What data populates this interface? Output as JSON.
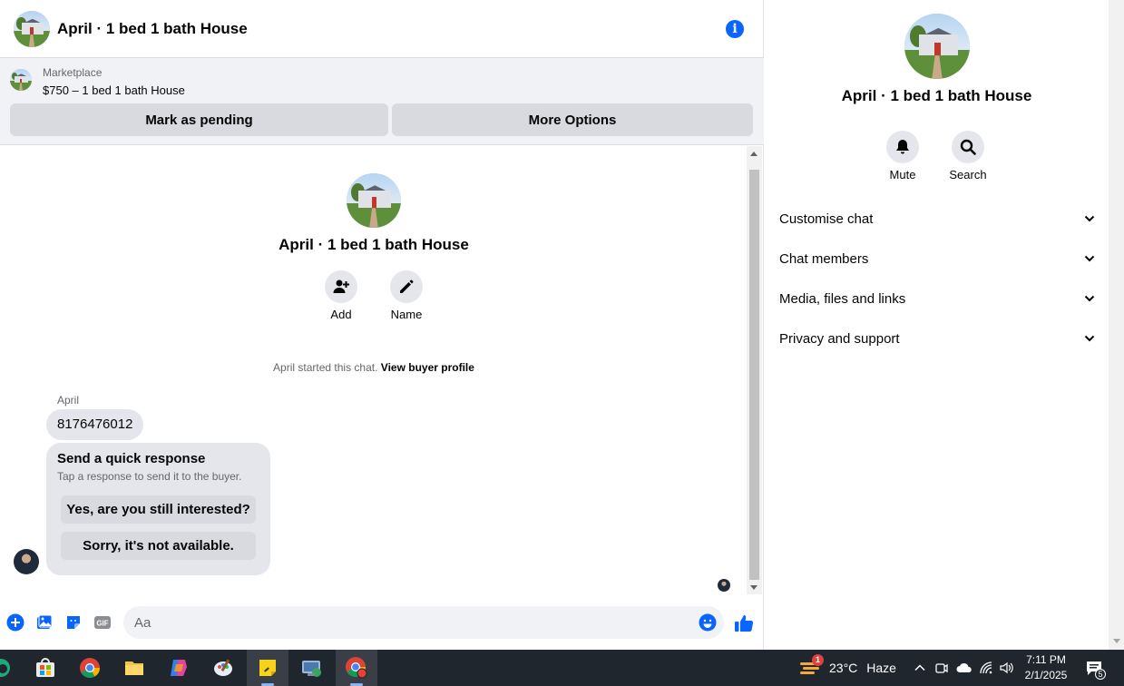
{
  "header": {
    "title": "April · 1 bed 1 bath House",
    "info_icon": "i"
  },
  "listing": {
    "source": "Marketplace",
    "price_title": "$750 – 1 bed 1 bath House",
    "mark_pending_label": "Mark as pending",
    "more_options_label": "More Options"
  },
  "intro": {
    "title": "April · 1 bed 1 bath House",
    "add_label": "Add",
    "name_label": "Name",
    "started_text": "April started this chat.",
    "view_profile_label": "View buyer profile"
  },
  "messages": {
    "sender": "April",
    "phone": "8176476012",
    "quick_title": "Send a quick response",
    "quick_subtitle": "Tap a response to send it to the buyer.",
    "quick_options": [
      "Yes, are you still interested?",
      "Sorry, it's not available."
    ]
  },
  "composer": {
    "placeholder": "Aa",
    "gif_label": "GIF"
  },
  "sidebar": {
    "title": "April · 1 bed 1 bath House",
    "mute_label": "Mute",
    "search_label": "Search",
    "sections": [
      "Customise chat",
      "Chat members",
      "Media, files and links",
      "Privacy and support"
    ]
  },
  "taskbar": {
    "weather_temp": "23°C",
    "weather_desc": "Haze",
    "weather_badge": "1",
    "time": "7:11 PM",
    "date": "2/1/2025",
    "notification_count": "5",
    "apps": [
      "edge-icon",
      "store-icon",
      "chrome-icon",
      "files-icon",
      "copilot-icon",
      "paint-icon",
      "sticky-notes-icon",
      "app-icon",
      "chrome-profile-icon"
    ]
  },
  "colors": {
    "accent": "#0866ff",
    "bubble": "#e4e6eb",
    "taskbar": "#20262e"
  }
}
